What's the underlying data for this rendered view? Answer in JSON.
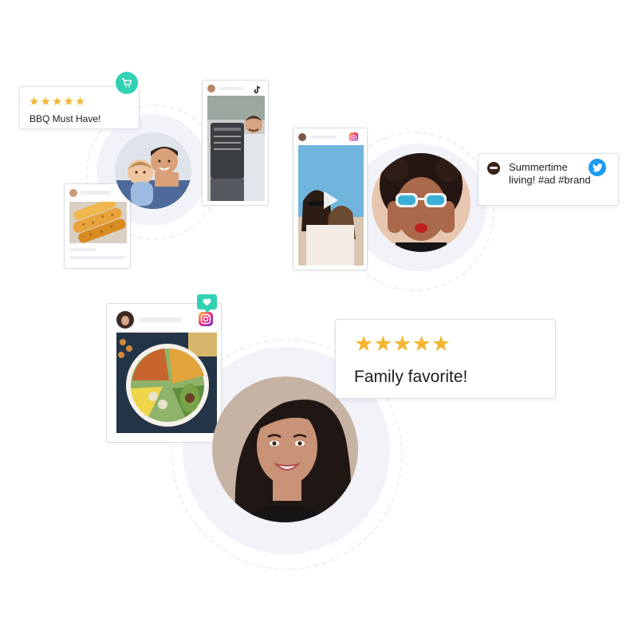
{
  "reviews": {
    "bbq": {
      "rating": 5,
      "stars": "★★★★★",
      "text": "BBQ Must Have!"
    },
    "family": {
      "rating": 5,
      "stars": "★★★★★",
      "text": "Family favorite!"
    }
  },
  "tweet": {
    "text_line1": "Summertime",
    "text_line2": "living! #ad #brand"
  },
  "icons": {
    "cart": "shopping-cart-icon",
    "tiktok": "tiktok-icon",
    "instagram": "instagram-icon",
    "twitter": "twitter-icon",
    "heart": "heart-icon",
    "play": "play-icon"
  },
  "colors": {
    "star": "#f4b531",
    "teal_badge": "#33d1b4",
    "twitter_blue": "#1d9bf0",
    "halo": "#f2f3f9",
    "card_border": "#dcdfe6"
  }
}
